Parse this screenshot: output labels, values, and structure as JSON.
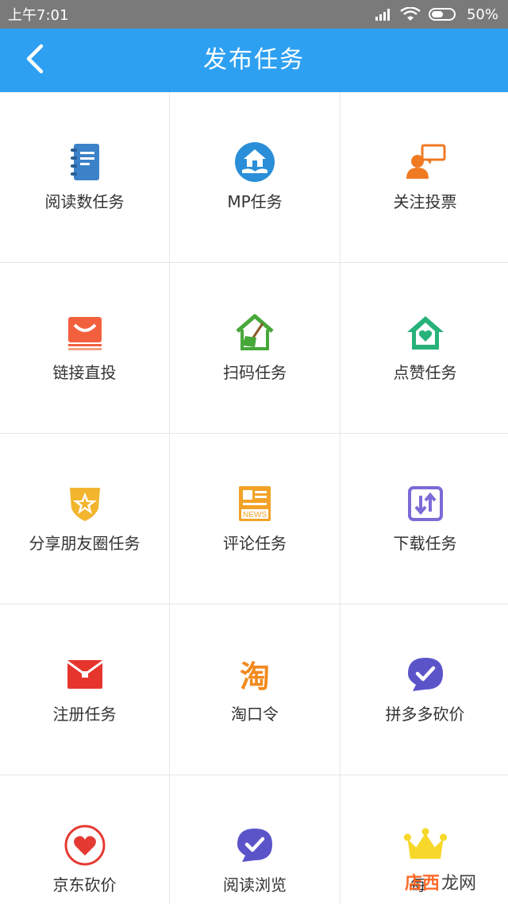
{
  "status_bar": {
    "time": "上午7:01",
    "battery": "50%"
  },
  "nav": {
    "title": "发布任务"
  },
  "tasks": [
    {
      "label": "阅读数任务",
      "icon": "notebook-icon",
      "color": "#3b82c9"
    },
    {
      "label": "MP任务",
      "icon": "house-hand-icon",
      "color": "#2a8fd8"
    },
    {
      "label": "关注投票",
      "icon": "person-chat-icon",
      "color": "#f07a22"
    },
    {
      "label": "链接直投",
      "icon": "mail-inbox-icon",
      "color": "#f2603e"
    },
    {
      "label": "扫码任务",
      "icon": "house-broom-icon",
      "color": "#47a83a"
    },
    {
      "label": "点赞任务",
      "icon": "house-heart-icon",
      "color": "#27b27a"
    },
    {
      "label": "分享朋友圈任务",
      "icon": "star-badge-icon",
      "color": "#f2b52d"
    },
    {
      "label": "评论任务",
      "icon": "newspaper-icon",
      "color": "#f2a227"
    },
    {
      "label": "下载任务",
      "icon": "transfer-arrows-icon",
      "color": "#7c6ad6"
    },
    {
      "label": "注册任务",
      "icon": "red-envelope-icon",
      "color": "#e5352d"
    },
    {
      "label": "淘口令",
      "icon": "taobao-icon",
      "color": "#f28a1e"
    },
    {
      "label": "拼多多砍价",
      "icon": "check-bubble-icon",
      "color": "#5b54c9"
    },
    {
      "label": "京东砍价",
      "icon": "heart-circle-icon",
      "color": "#e53a32"
    },
    {
      "label": "阅读浏览",
      "icon": "check-bubble-icon",
      "color": "#5b54c9"
    },
    {
      "label": "每",
      "icon": "crown-icon",
      "color": "#f7d82a"
    }
  ],
  "watermark": {
    "brand": "店西",
    "suffix": "龙网"
  }
}
